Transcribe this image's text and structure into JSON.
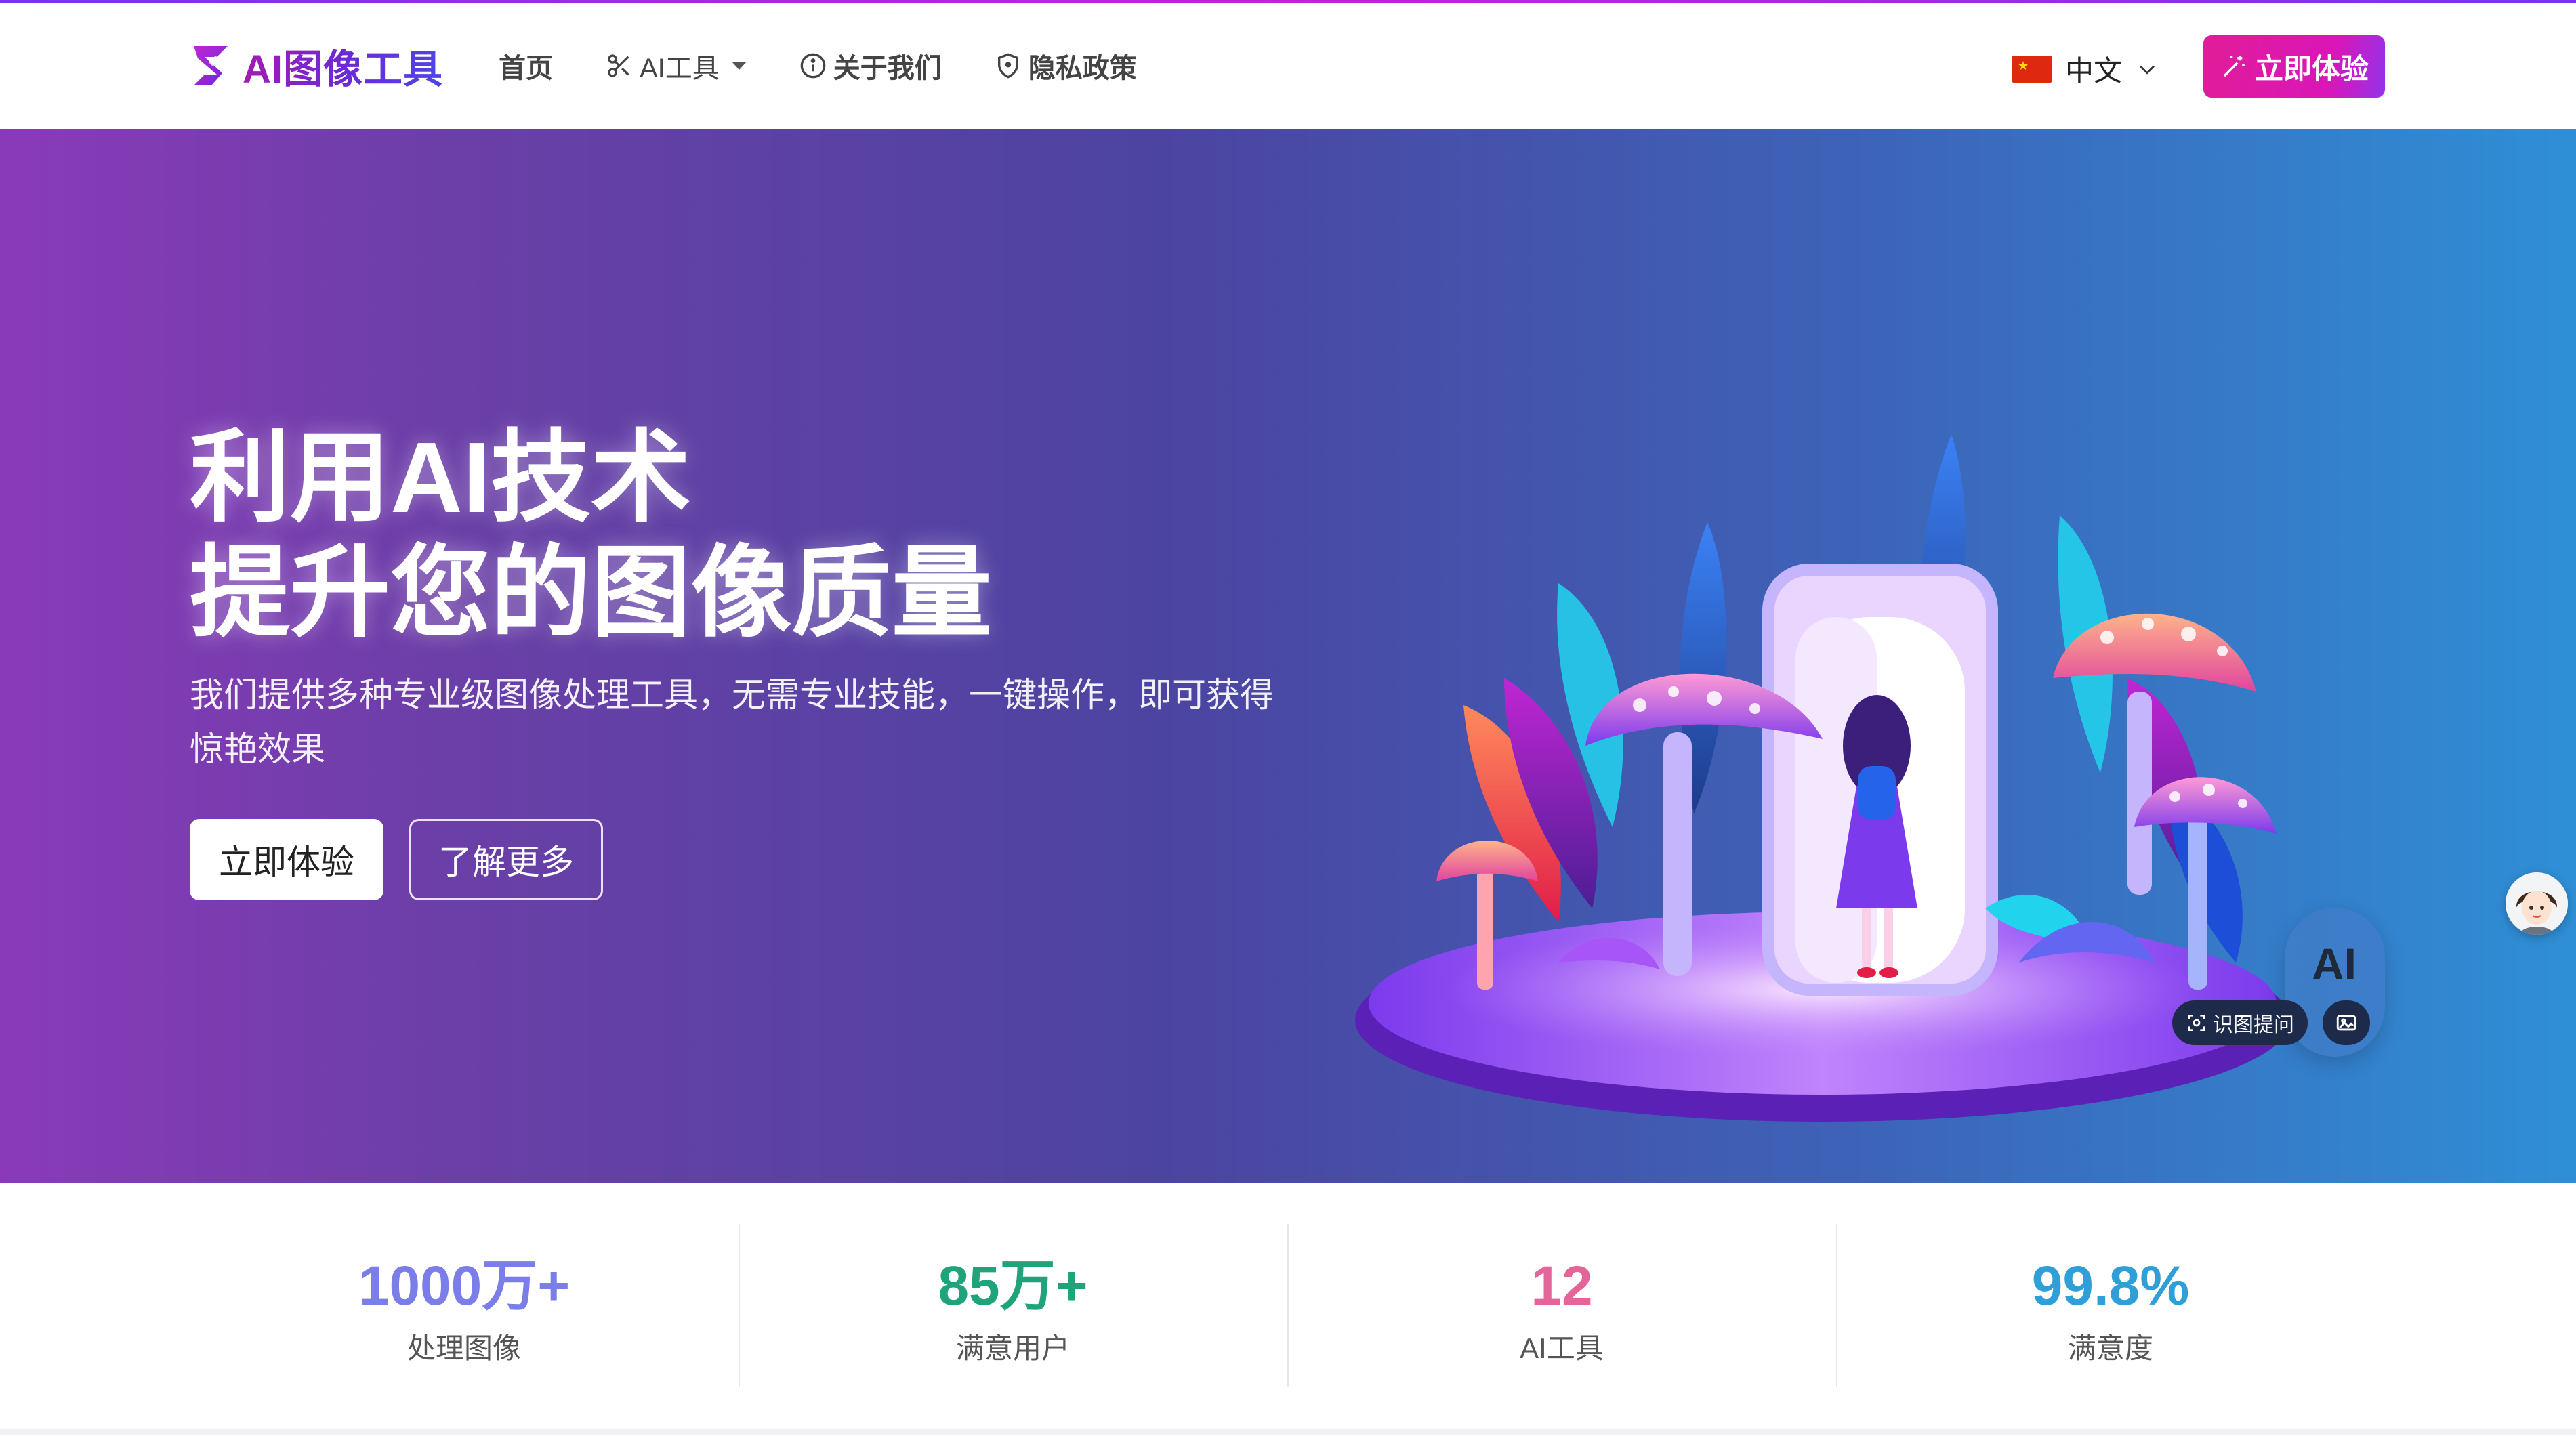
{
  "brand": {
    "name": "AI图像工具",
    "logo_icon": "s-logo-icon"
  },
  "nav": {
    "home": "首页",
    "tools": "AI工具",
    "about": "关于我们",
    "privacy": "隐私政策"
  },
  "language": {
    "current": "中文",
    "flag": "china-flag-icon"
  },
  "header_cta": "立即体验",
  "hero": {
    "title_line1": "利用AI技术",
    "title_line2": "提升您的图像质量",
    "subtitle": "我们提供多种专业级图像处理工具，无需专业技能，一键操作，即可获得惊艳效果",
    "primary_button": "立即体验",
    "secondary_button": "了解更多"
  },
  "floating": {
    "ai_label": "AI",
    "ask_image": "识图提问"
  },
  "stats": [
    {
      "value": "1000万+",
      "label": "处理图像",
      "color": "#7b7ee8"
    },
    {
      "value": "85万+",
      "label": "满意用户",
      "color": "#1ea37a"
    },
    {
      "value": "12",
      "label": "AI工具",
      "color": "#e5649a"
    },
    {
      "value": "99.8%",
      "label": "满意度",
      "color": "#2f9fd8"
    }
  ],
  "colors": {
    "accent_pink": "#e11d98",
    "hero_start": "#8a3ab9",
    "hero_end": "#2f8fd6"
  }
}
